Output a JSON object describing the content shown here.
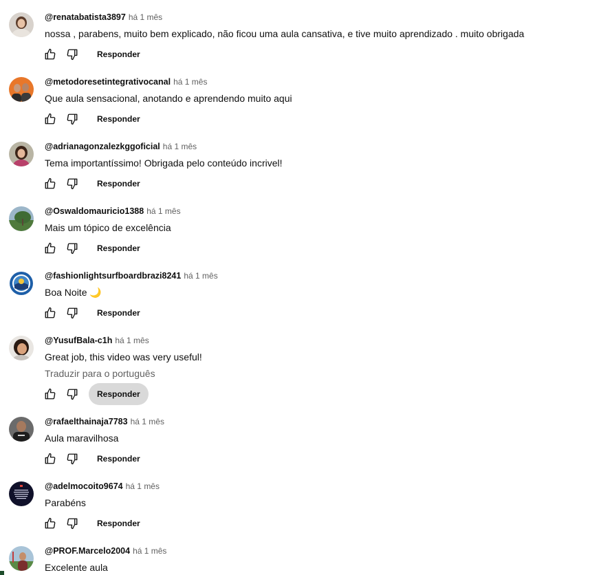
{
  "reply_label": "Responder",
  "translate_label": "Traduzir para o português",
  "comments": [
    {
      "handle": "@renatabatista3897",
      "time": "há 1 mês",
      "text": "nossa , parabens, muito bem explicado, não ficou uma aula cansativa, e tive muito aprendizado . muito obrigada"
    },
    {
      "handle": "@metodoresetintegrativocanal",
      "time": "há 1 mês",
      "text": "Que aula sensacional, anotando e aprendendo muito aqui"
    },
    {
      "handle": "@adrianagonzalezkggoficial",
      "time": "há 1 mês",
      "text": "Tema importantíssimo! Obrigada pelo conteúdo incrivel!"
    },
    {
      "handle": "@Oswaldomauricio1388",
      "time": "há 1 mês",
      "text": "Mais um tópico de excelência"
    },
    {
      "handle": "@fashionlightsurfboardbrazi8241",
      "time": "há 1 mês",
      "text": "Boa Noite 🌙"
    },
    {
      "handle": "@YusufBala-c1h",
      "time": "há 1 mês",
      "text": "Great job, this video was very useful!"
    },
    {
      "handle": "@rafaelthainaja7783",
      "time": "há 1 mês",
      "text": "Aula maravilhosa"
    },
    {
      "handle": "@adelmocoito9674",
      "time": "há 1 mês",
      "text": "Parabéns"
    },
    {
      "handle": "@PROF.Marcelo2004",
      "time": "há 1 mês",
      "text": "Excelente aula"
    }
  ],
  "icons": {
    "like": "thumbs-up-icon",
    "dislike": "thumbs-down-icon"
  }
}
